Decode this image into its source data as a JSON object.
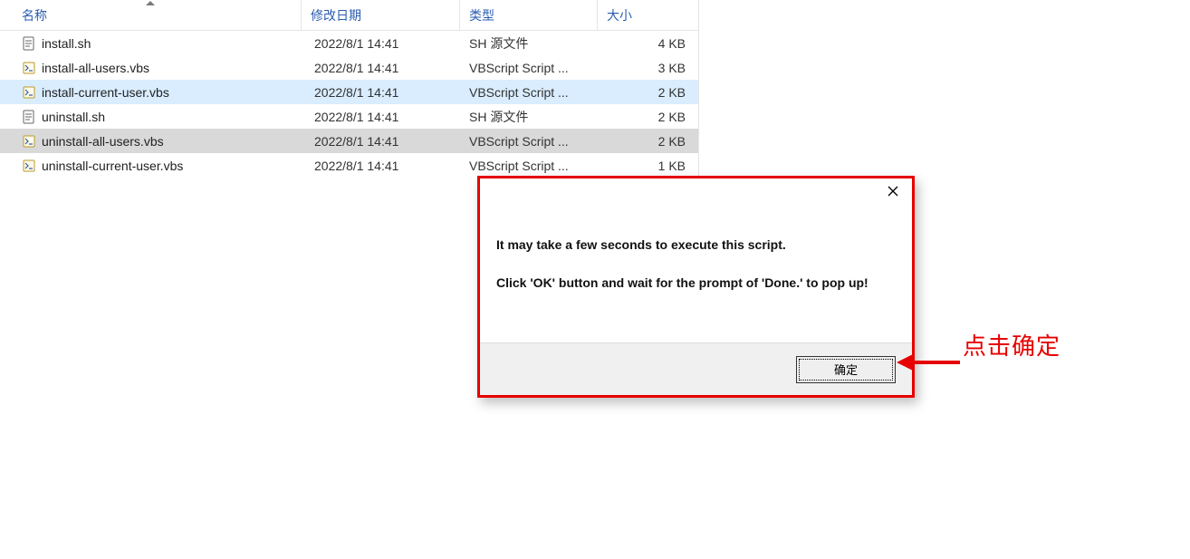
{
  "columns": {
    "name": "名称",
    "date": "修改日期",
    "type": "类型",
    "size": "大小"
  },
  "files": [
    {
      "icon": "sh",
      "name": "install.sh",
      "date": "2022/8/1 14:41",
      "type": "SH 源文件",
      "size": "4 KB",
      "state": ""
    },
    {
      "icon": "vbs",
      "name": "install-all-users.vbs",
      "date": "2022/8/1 14:41",
      "type": "VBScript Script ...",
      "size": "3 KB",
      "state": ""
    },
    {
      "icon": "vbs",
      "name": "install-current-user.vbs",
      "date": "2022/8/1 14:41",
      "type": "VBScript Script ...",
      "size": "2 KB",
      "state": "selected"
    },
    {
      "icon": "sh",
      "name": "uninstall.sh",
      "date": "2022/8/1 14:41",
      "type": "SH 源文件",
      "size": "2 KB",
      "state": ""
    },
    {
      "icon": "vbs",
      "name": "uninstall-all-users.vbs",
      "date": "2022/8/1 14:41",
      "type": "VBScript Script ...",
      "size": "2 KB",
      "state": "highlight"
    },
    {
      "icon": "vbs",
      "name": "uninstall-current-user.vbs",
      "date": "2022/8/1 14:41",
      "type": "VBScript Script ...",
      "size": "1 KB",
      "state": ""
    }
  ],
  "dialog": {
    "line1": "It may take a few seconds to execute this script.",
    "line2": "Click 'OK' button and wait for the prompt of 'Done.' to pop up!",
    "ok_label": "确定"
  },
  "annotation": {
    "text": "点击确定",
    "color": "#e60000"
  }
}
